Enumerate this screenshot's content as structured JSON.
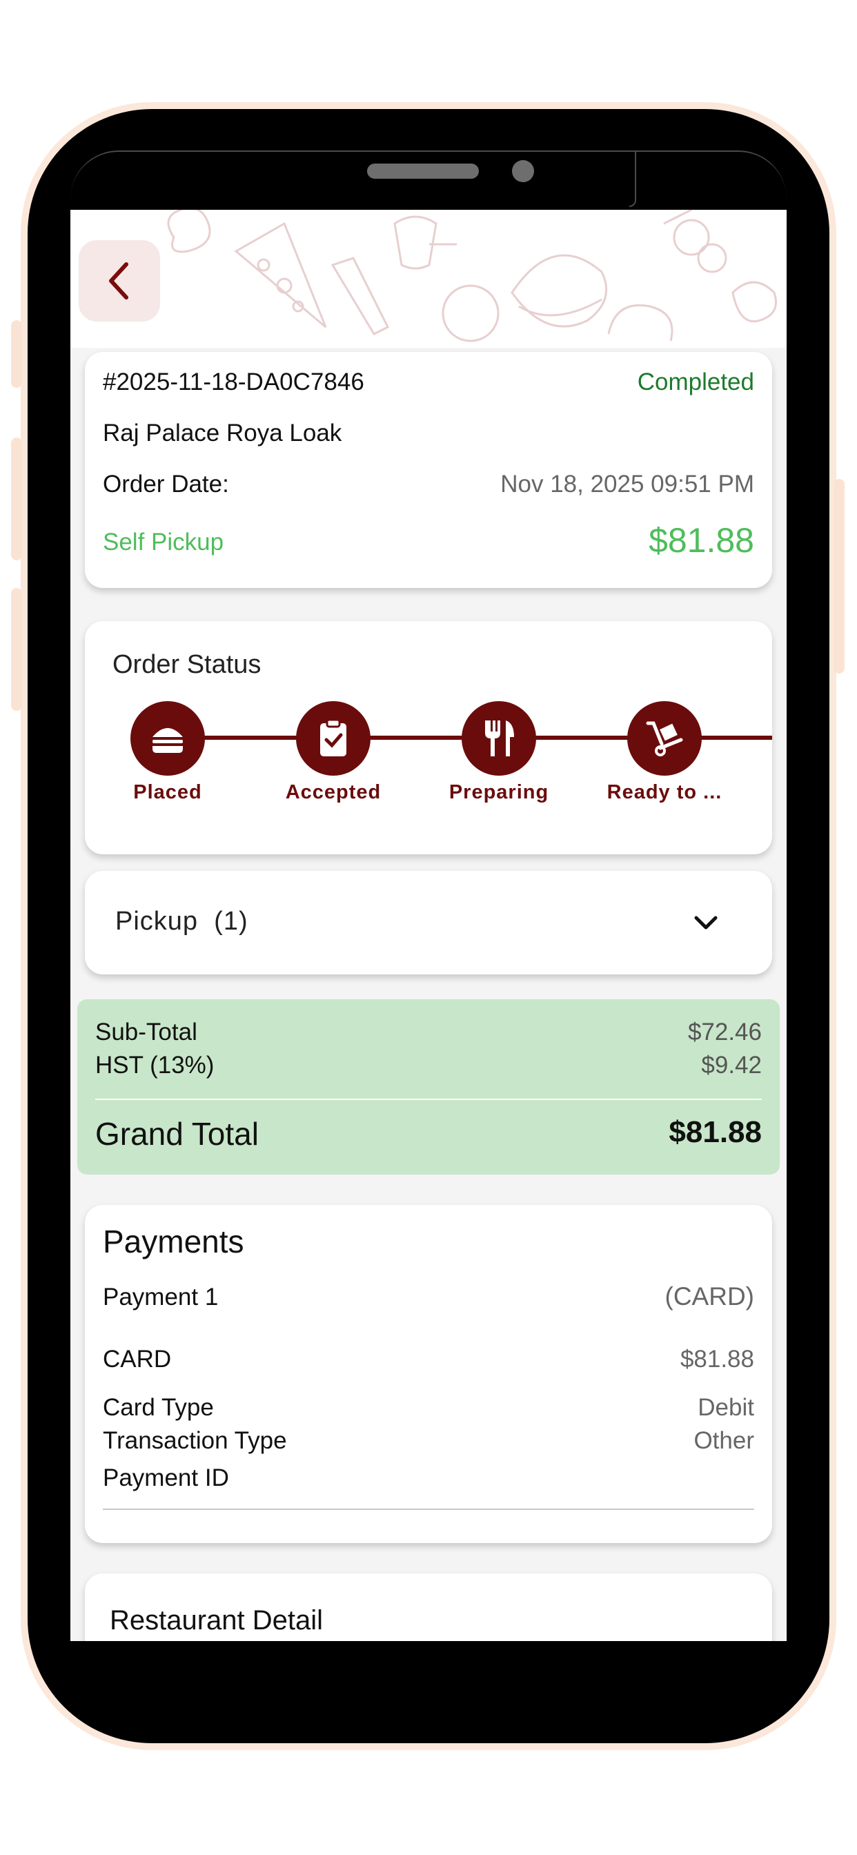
{
  "order": {
    "id": "#2025-11-18-DA0C7846",
    "status": "Completed",
    "restaurant": "Raj Palace Roya Loak",
    "date_label": "Order Date:",
    "date_value": "Nov 18, 2025 09:51 PM",
    "fulfillment": "Self Pickup",
    "total": "$81.88"
  },
  "order_status": {
    "title": "Order Status",
    "steps": [
      {
        "label": "Placed",
        "icon": "burger-icon"
      },
      {
        "label": "Accepted",
        "icon": "clipboard-check-icon"
      },
      {
        "label": "Preparing",
        "icon": "fork-knife-icon"
      },
      {
        "label": "Ready to ...",
        "icon": "hand-truck-icon"
      }
    ]
  },
  "pickup": {
    "label": "Pickup  (1)"
  },
  "totals": {
    "subtotal_label": "Sub-Total",
    "subtotal_value": "$72.46",
    "tax_label": "HST (13%)",
    "tax_value": "$9.42",
    "grand_label": "Grand Total",
    "grand_value": "$81.88"
  },
  "payments": {
    "title": "Payments",
    "payment_label": "Payment 1",
    "payment_method": "(CARD)",
    "method_label": "CARD",
    "method_amount": "$81.88",
    "card_type_label": "Card Type",
    "card_type_value": "Debit",
    "transaction_type_label": "Transaction Type",
    "transaction_type_value": "Other",
    "payment_id_label": "Payment ID"
  },
  "restaurant_detail": {
    "title": "Restaurant Detail"
  },
  "colors": {
    "accent": "#6b0c0c",
    "status_completed": "#1f7a2c",
    "self_pickup": "#4ebd5b",
    "totals_bg": "#c8e6c9"
  }
}
